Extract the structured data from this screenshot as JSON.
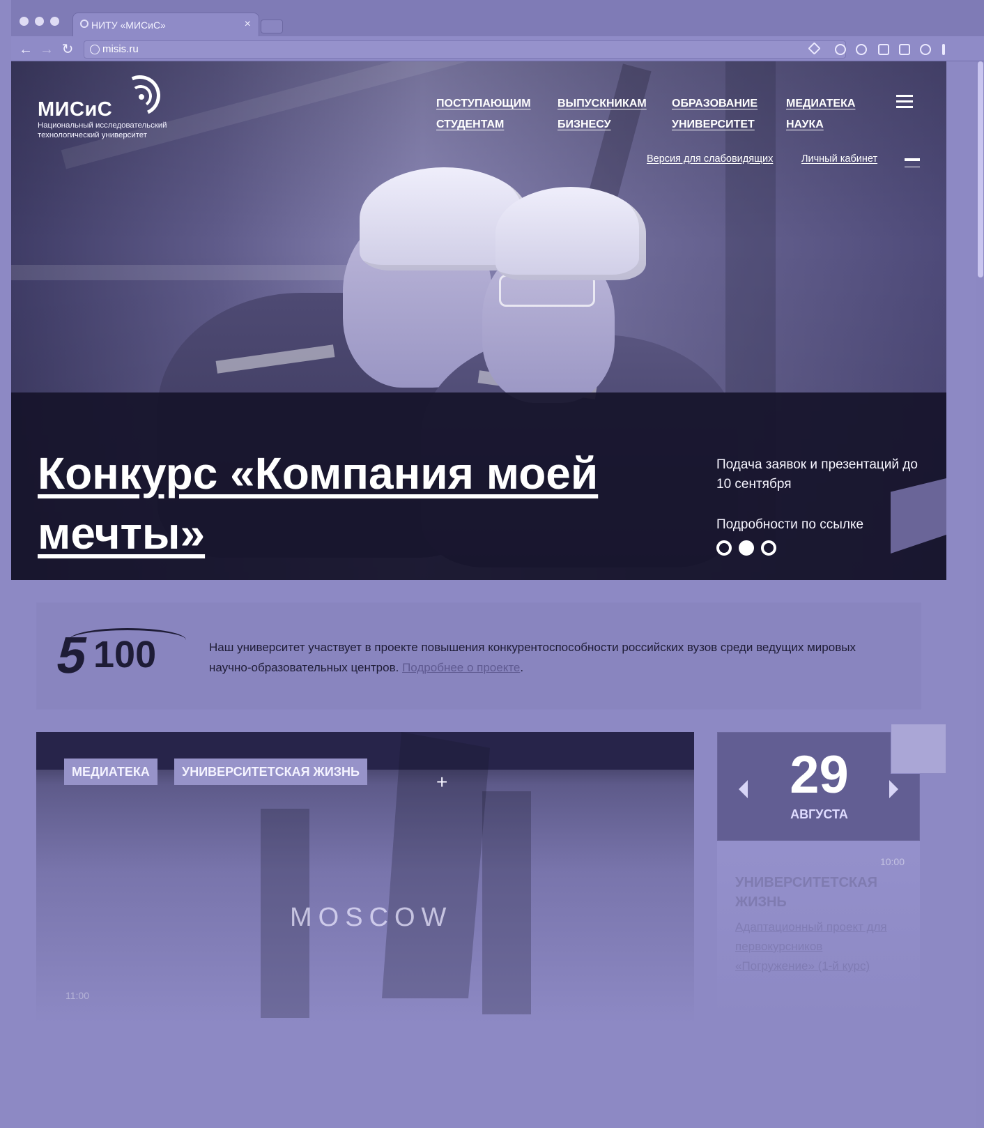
{
  "browser": {
    "tab_title": "НИТУ «МИСиС»",
    "tab_close": "×",
    "url": "misis.ru",
    "nav": {
      "back": "←",
      "forward": "→",
      "reload": "↻"
    },
    "icons": [
      "bookmark-star-icon",
      "pinterest-icon",
      "cloud-icon",
      "function-icon",
      "calendar-extension-icon",
      "extension-icon",
      "menu-icon"
    ]
  },
  "site": {
    "logo_text": "МИСиС",
    "logo_subtitle": "Национальный исследовательский\nтехнологический университет",
    "nav": [
      "ПОСТУПАЮЩИМ",
      "СТУДЕНТАМ",
      "ВЫПУСКНИКАМ",
      "БИЗНЕСУ",
      "ОБРАЗОВАНИЕ",
      "УНИВЕРСИТЕТ",
      "МЕДИАТЕКА",
      "НАУКА"
    ],
    "secondary_links": {
      "accessible": "Версия для слабовидящих",
      "cabinet": "Личный кабинет"
    }
  },
  "hero": {
    "title": "Конкурс «Компания моей мечты»",
    "deadline": "Подача заявок и презентаций до 10 сентября",
    "details": "Подробности по ссылке",
    "slides": [
      false,
      true,
      false
    ]
  },
  "project": {
    "logo": "5100",
    "text": "Наш университет участвует в проекте повышения конкурентоспособности российских вузов среди ведущих мировых научно-образовательных центров.",
    "link": "Подробнее о проекте",
    "after_link": "."
  },
  "news": {
    "tags": [
      "МЕДИАТЕКА",
      "УНИВЕРСИТЕТСКАЯ ЖИЗНЬ"
    ],
    "plus": "+",
    "image_text": "MOSCOW",
    "time": "11:00"
  },
  "calendar": {
    "day": "29",
    "month": "АВГУСТА"
  },
  "event": {
    "time": "10:00",
    "category": "УНИВЕРСИТЕТСКАЯ ЖИЗНЬ",
    "title": "Адаптационный проект для первокурсников «Погружение» (1-й курс)"
  }
}
